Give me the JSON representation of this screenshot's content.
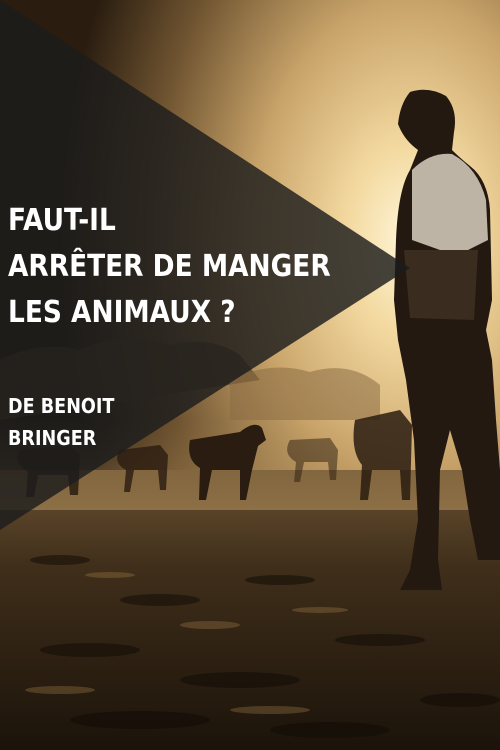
{
  "poster": {
    "title_lines": [
      "FAUT-IL",
      "ARRÊTER DE MANGER",
      "LES ANIMAUX ?"
    ],
    "credit_lines": [
      "DE BENOIT",
      "BRINGER"
    ]
  }
}
